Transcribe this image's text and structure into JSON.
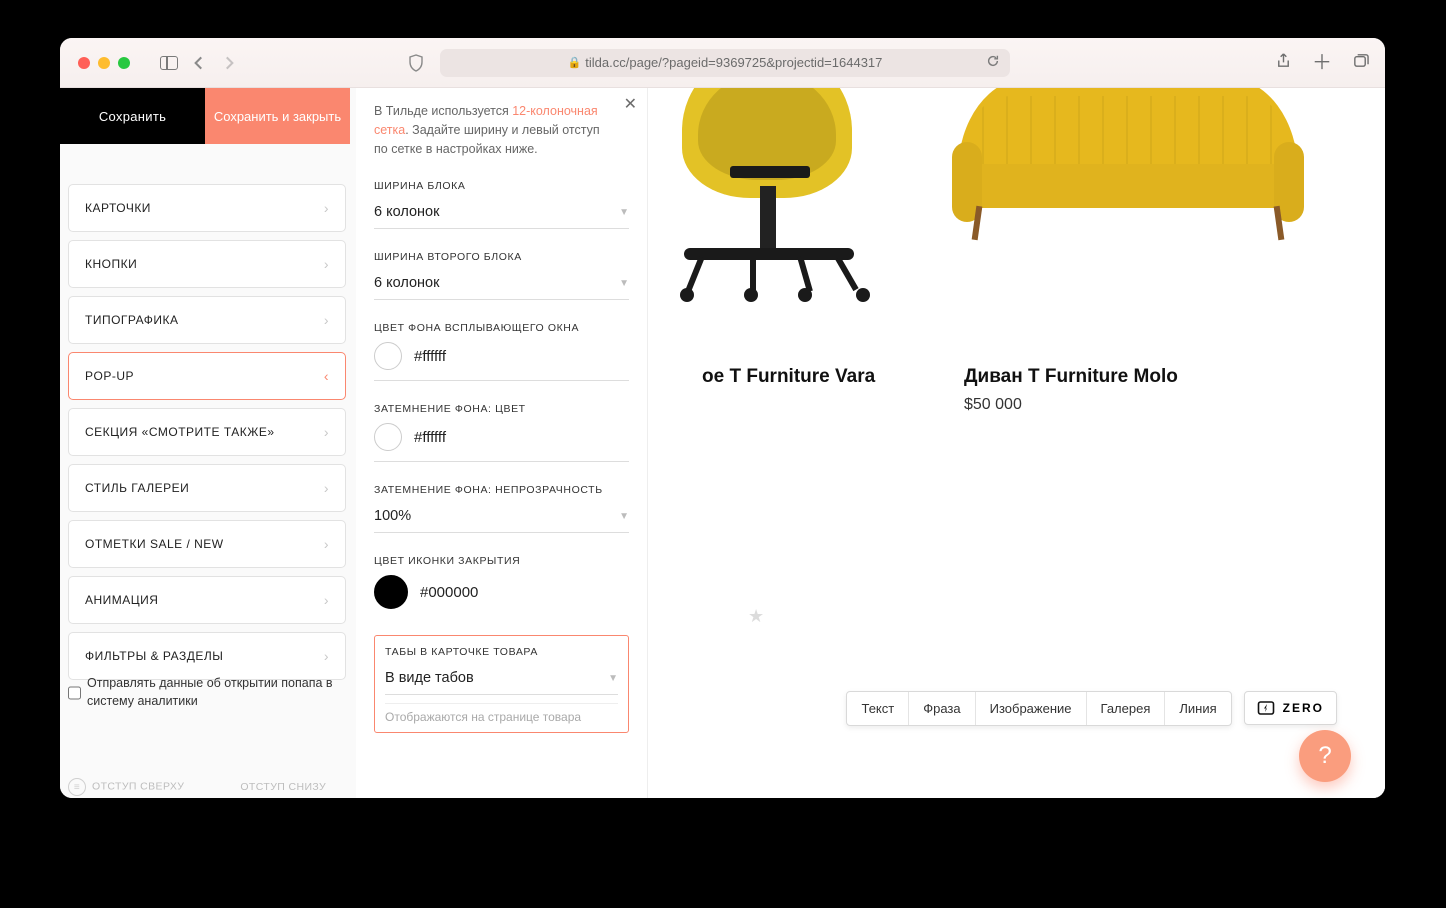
{
  "browser": {
    "url": "tilda.cc/page/?pageid=9369725&projectid=1644317"
  },
  "header": {
    "save": "Сохранить",
    "save_close": "Сохранить и закрыть"
  },
  "sidebar": {
    "items": [
      {
        "label": "КАРТОЧКИ"
      },
      {
        "label": "КНОПКИ"
      },
      {
        "label": "ТИПОГРАФИКА"
      },
      {
        "label": "POP-UP",
        "active": true
      },
      {
        "label": "СЕКЦИЯ «СМОТРИТЕ ТАКЖЕ»"
      },
      {
        "label": "СТИЛЬ ГАЛЕРЕИ"
      },
      {
        "label": "ОТМЕТКИ SALE / NEW"
      },
      {
        "label": "АНИМАЦИЯ"
      },
      {
        "label": "ФИЛЬТРЫ & РАЗДЕЛЫ"
      }
    ],
    "analytics_checkbox": "Отправлять данные об открытии попапа в систему аналитики",
    "padding_top": "ОТСТУП СВЕРХУ",
    "padding_bottom": "ОТСТУП СНИЗУ"
  },
  "popout": {
    "intro_prefix": "В Тильде используется ",
    "intro_link": "12-колоночная сетка",
    "intro_suffix": ". Задайте ширину и левый отступ по сетке в настройках ниже.",
    "block_width_label": "ШИРИНА БЛОКА",
    "block_width_value": "6 колонок",
    "block2_width_label": "ШИРИНА ВТОРОГО БЛОКА",
    "block2_width_value": "6 колонок",
    "popup_bg_label": "ЦВЕТ ФОНА ВСПЛЫВАЮЩЕГО ОКНА",
    "popup_bg_value": "#ffffff",
    "overlay_color_label": "ЗАТЕМНЕНИЕ ФОНА: ЦВЕТ",
    "overlay_color_value": "#ffffff",
    "overlay_opacity_label": "ЗАТЕМНЕНИЕ ФОНА: НЕПРОЗРАЧНОСТЬ",
    "overlay_opacity_value": "100%",
    "close_icon_label": "ЦВЕТ ИКОНКИ ЗАКРЫТИЯ",
    "close_icon_value": "#000000",
    "tabs_label": "ТАБЫ В КАРТОЧКЕ ТОВАРА",
    "tabs_value": "В виде табов",
    "tabs_hint": "Отображаются на странице товара"
  },
  "products": {
    "p1": {
      "title": "ое T Furniture Vara"
    },
    "p2": {
      "title": "Диван T Furniture Molo",
      "price": "$50 000"
    }
  },
  "toolbar": {
    "items": [
      "Текст",
      "Фраза",
      "Изображение",
      "Галерея",
      "Линия"
    ],
    "zero": "ZERO"
  },
  "colors": {
    "accent": "#fa876f",
    "white": "#ffffff",
    "black": "#000000"
  }
}
